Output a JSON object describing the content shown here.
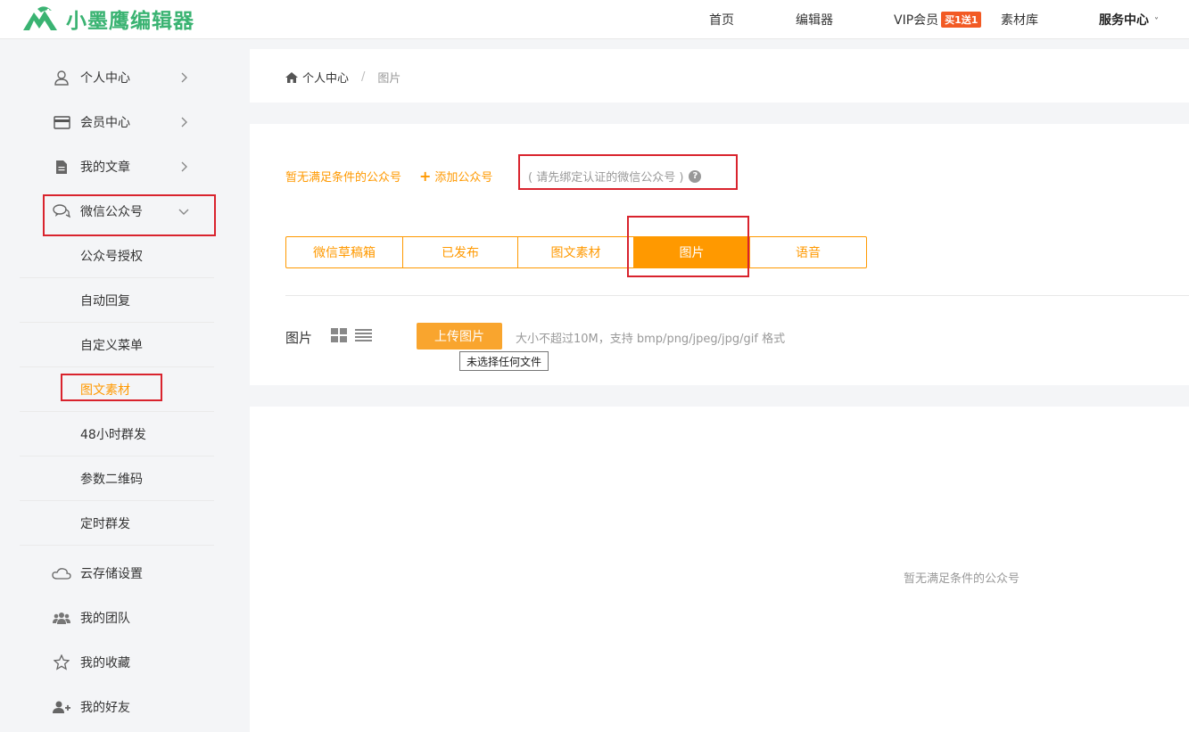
{
  "header": {
    "logo_text": "小墨鹰编辑器",
    "nav": {
      "home": "首页",
      "editor": "编辑器",
      "vip": "VIP会员",
      "vip_badge": "买1送1",
      "library": "素材库",
      "service": "服务中心"
    }
  },
  "sidebar": {
    "items": [
      {
        "label": "个人中心",
        "icon": "user-icon"
      },
      {
        "label": "会员中心",
        "icon": "card-icon"
      },
      {
        "label": "我的文章",
        "icon": "document-icon"
      },
      {
        "label": "微信公众号",
        "icon": "chat-icon"
      }
    ],
    "sub_items": [
      {
        "label": "公众号授权"
      },
      {
        "label": "自动回复"
      },
      {
        "label": "自定义菜单"
      },
      {
        "label": "图文素材"
      },
      {
        "label": "48小时群发"
      },
      {
        "label": "参数二维码"
      },
      {
        "label": "定时群发"
      }
    ],
    "bottom_items": [
      {
        "label": "云存储设置",
        "icon": "cloud-icon"
      },
      {
        "label": "我的团队",
        "icon": "team-icon"
      },
      {
        "label": "我的收藏",
        "icon": "star-icon"
      },
      {
        "label": "我的好友",
        "icon": "add-friend-icon"
      }
    ]
  },
  "breadcrumb": {
    "home": "个人中心",
    "separator": "/",
    "current": "图片"
  },
  "account": {
    "status": "暂无满足条件的公众号",
    "add_label": "添加公众号",
    "hint": "( 请先绑定认证的微信公众号 )"
  },
  "tabs": [
    {
      "label": "微信草稿箱"
    },
    {
      "label": "已发布"
    },
    {
      "label": "图文素材"
    },
    {
      "label": "图片"
    },
    {
      "label": "语音"
    }
  ],
  "images": {
    "label": "图片",
    "upload_label": "上传图片",
    "upload_hint": "大小不超过10M，支持 bmp/png/jpeg/jpg/gif 格式",
    "file_tooltip": "未选择任何文件"
  },
  "empty_state": "暂无满足条件的公众号",
  "colors": {
    "accent": "#ff9900",
    "brand": "#3ab372",
    "highlight_box": "#d9232d"
  }
}
